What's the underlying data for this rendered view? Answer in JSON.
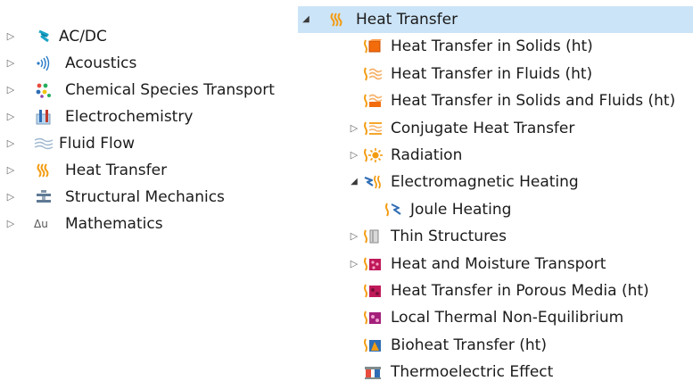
{
  "left_tree": {
    "items": [
      {
        "label": "AC/DC",
        "icon": "acdc-icon"
      },
      {
        "label": "Acoustics",
        "icon": "acoustics-icon"
      },
      {
        "label": "Chemical Species Transport",
        "icon": "chemical-species-icon"
      },
      {
        "label": "Electrochemistry",
        "icon": "electrochemistry-icon"
      },
      {
        "label": "Fluid Flow",
        "icon": "fluid-flow-icon"
      },
      {
        "label": "Heat Transfer",
        "icon": "heat-transfer-icon"
      },
      {
        "label": "Structural Mechanics",
        "icon": "structural-mechanics-icon"
      },
      {
        "label": "Mathematics",
        "icon": "mathematics-icon",
        "icon_text": "Δu"
      }
    ]
  },
  "right_tree": {
    "header": {
      "label": "Heat Transfer",
      "icon": "heat-transfer-icon",
      "expanded": true,
      "selected": true
    },
    "items": [
      {
        "label": "Heat Transfer in Solids (ht)",
        "icon": "heat-transfer-solids-icon"
      },
      {
        "label": "Heat Transfer in Fluids (ht)",
        "icon": "heat-transfer-fluids-icon"
      },
      {
        "label": "Heat Transfer in Solids and Fluids (ht)",
        "icon": "heat-transfer-solids-fluids-icon"
      },
      {
        "label": "Conjugate Heat Transfer",
        "icon": "conjugate-heat-transfer-icon",
        "expandable": true
      },
      {
        "label": "Radiation",
        "icon": "radiation-icon",
        "expandable": true
      },
      {
        "label": "Electromagnetic Heating",
        "icon": "electromagnetic-heating-icon",
        "expanded": true
      },
      {
        "label": "Joule Heating",
        "icon": "joule-heating-icon"
      },
      {
        "label": "Thin Structures",
        "icon": "thin-structures-icon",
        "expandable": true
      },
      {
        "label": "Heat and Moisture Transport",
        "icon": "heat-moisture-icon",
        "expandable": true
      },
      {
        "label": "Heat Transfer in Porous Media (ht)",
        "icon": "porous-media-icon"
      },
      {
        "label": "Local Thermal Non-Equilibrium",
        "icon": "thermal-non-equilibrium-icon"
      },
      {
        "label": "Bioheat Transfer (ht)",
        "icon": "bioheat-icon"
      },
      {
        "label": "Thermoelectric Effect",
        "icon": "thermoelectric-icon"
      }
    ]
  },
  "colors": {
    "selection": "#cce4f7",
    "heat_orange": "#f39c12",
    "solid_orange": "#f26c0c",
    "acdc_teal": "#1aa3c7",
    "magenta": "#c0195a",
    "electro_blue": "#2f6db5"
  }
}
